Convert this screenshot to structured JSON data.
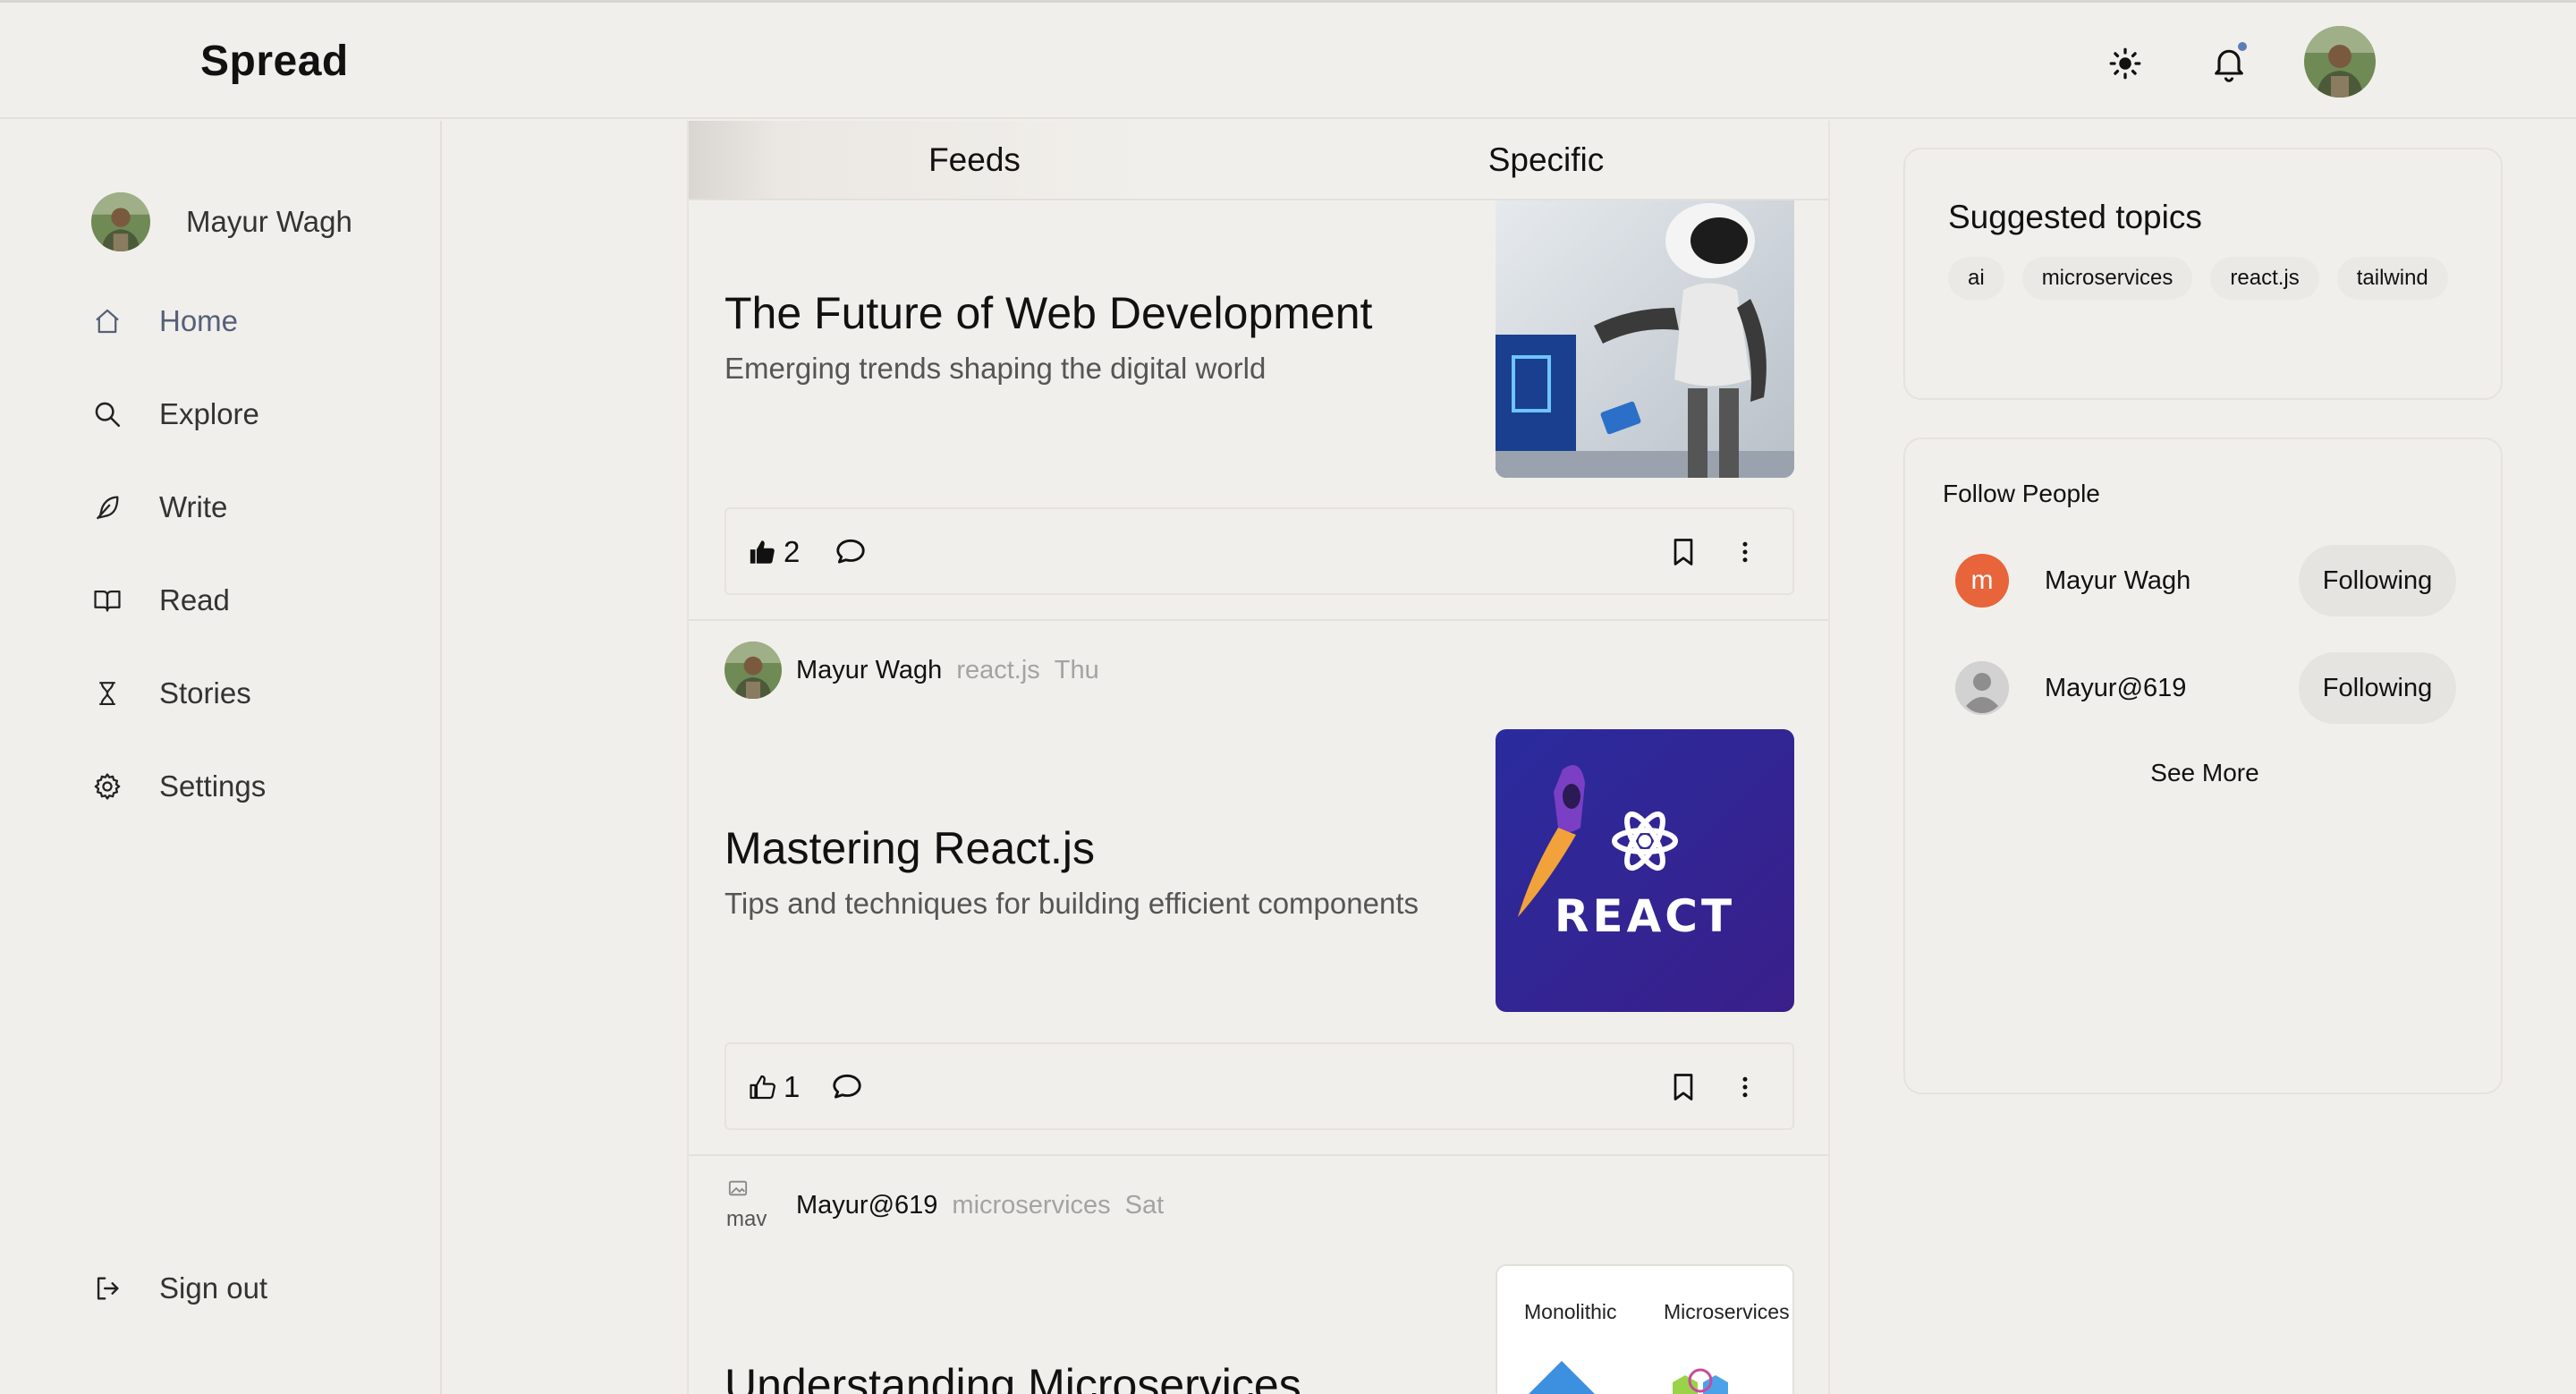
{
  "brand": "Spread",
  "header": {
    "theme_icon": "sun-icon",
    "notifications_icon": "bell-icon"
  },
  "sidebar": {
    "user_name": "Mayur Wagh",
    "items": [
      {
        "label": "Home",
        "icon": "home-icon"
      },
      {
        "label": "Explore",
        "icon": "search-icon"
      },
      {
        "label": "Write",
        "icon": "feather-icon"
      },
      {
        "label": "Read",
        "icon": "book-icon"
      },
      {
        "label": "Stories",
        "icon": "hourglass-icon"
      },
      {
        "label": "Settings",
        "icon": "gear-icon"
      }
    ],
    "sign_out": "Sign out"
  },
  "tabs": [
    "Feeds",
    "Specific"
  ],
  "posts": [
    {
      "title": "The Future of Web Development",
      "subtitle": "Emerging trends shaping the digital world",
      "likes": "2"
    },
    {
      "author": "Mayur Wagh",
      "topic": "react.js",
      "day": "Thu",
      "title": "Mastering React.js",
      "subtitle": "Tips and techniques for building efficient components",
      "image_text": "REACT",
      "likes": "1"
    },
    {
      "author": "Mayur@619",
      "topic": "microservices",
      "day": "Sat",
      "avatar_alt": "mav",
      "title": "Understanding Microservices",
      "image_labels": [
        "Monolithic",
        "Microservices"
      ]
    }
  ],
  "suggested": {
    "title": "Suggested topics",
    "topics": [
      "ai",
      "microservices",
      "react.js",
      "tailwind"
    ]
  },
  "follow": {
    "title": "Follow People",
    "people": [
      {
        "initial": "m",
        "name": "Mayur Wagh",
        "button": "Following"
      },
      {
        "name": "Mayur@619",
        "button": "Following"
      }
    ],
    "see_more": "See More"
  },
  "colors": {
    "background": "#f1efeb",
    "accent_orange": "#e8643a",
    "notification_dot": "#5b7db7"
  }
}
